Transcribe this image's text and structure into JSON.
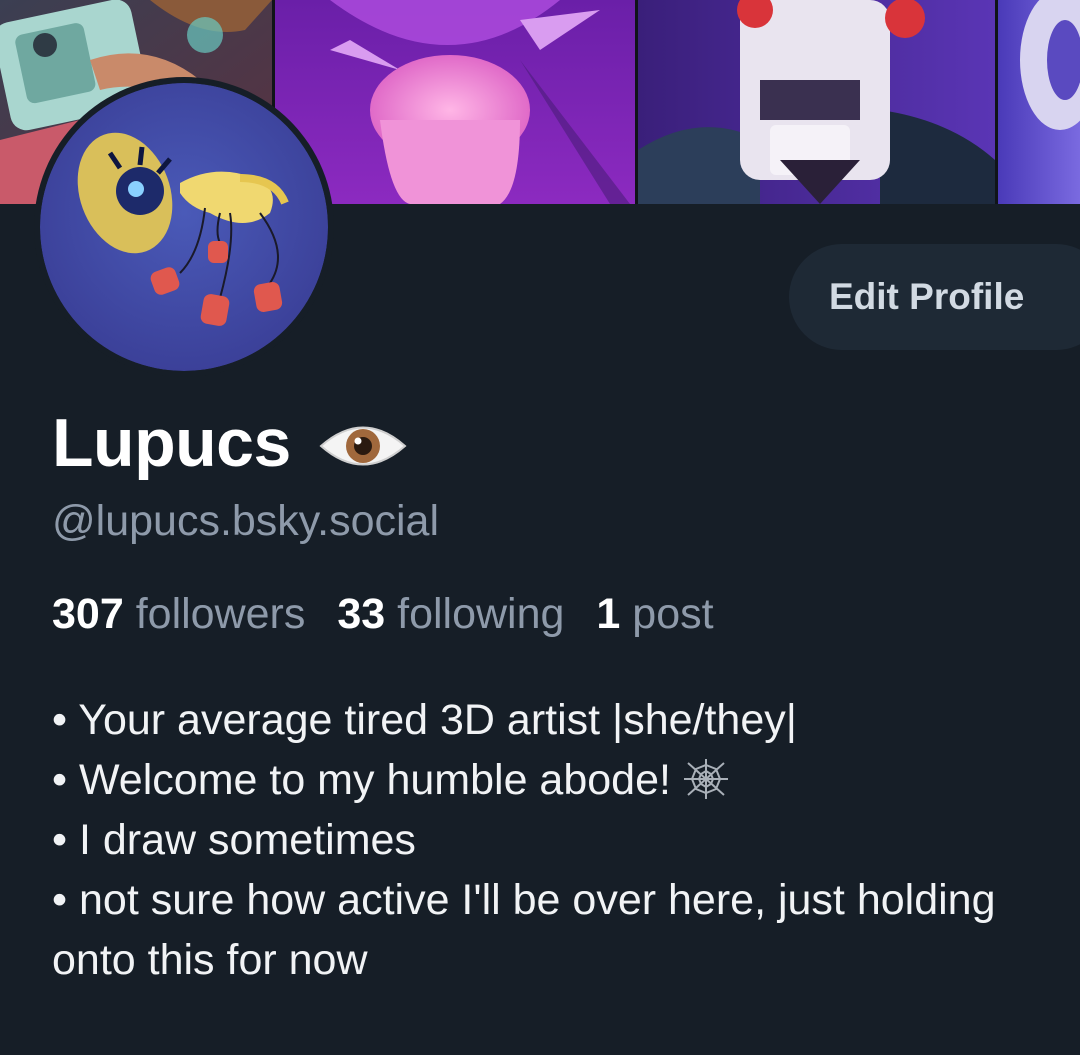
{
  "profile": {
    "display_name": "Lupucs",
    "handle": "@lupucs.bsky.social",
    "name_emoji_icon": "eye-icon"
  },
  "actions": {
    "edit_profile_label": "Edit Profile"
  },
  "stats": {
    "followers_count": "307",
    "followers_label": "followers",
    "following_count": "33",
    "following_label": "following",
    "posts_count": "1",
    "posts_label": "post"
  },
  "bio": {
    "lines": [
      "• Your average tired 3D artist |she/they|",
      "• Welcome to my humble abode!",
      "• I draw sometimes",
      "• not sure how active I'll be over here, just holding onto this for now"
    ],
    "line2_emoji_icon": "spider-web-icon"
  },
  "colors": {
    "background": "#161e27",
    "button_bg": "#1e2935",
    "muted_text": "#8e9aaa",
    "primary_text": "#ffffff"
  }
}
